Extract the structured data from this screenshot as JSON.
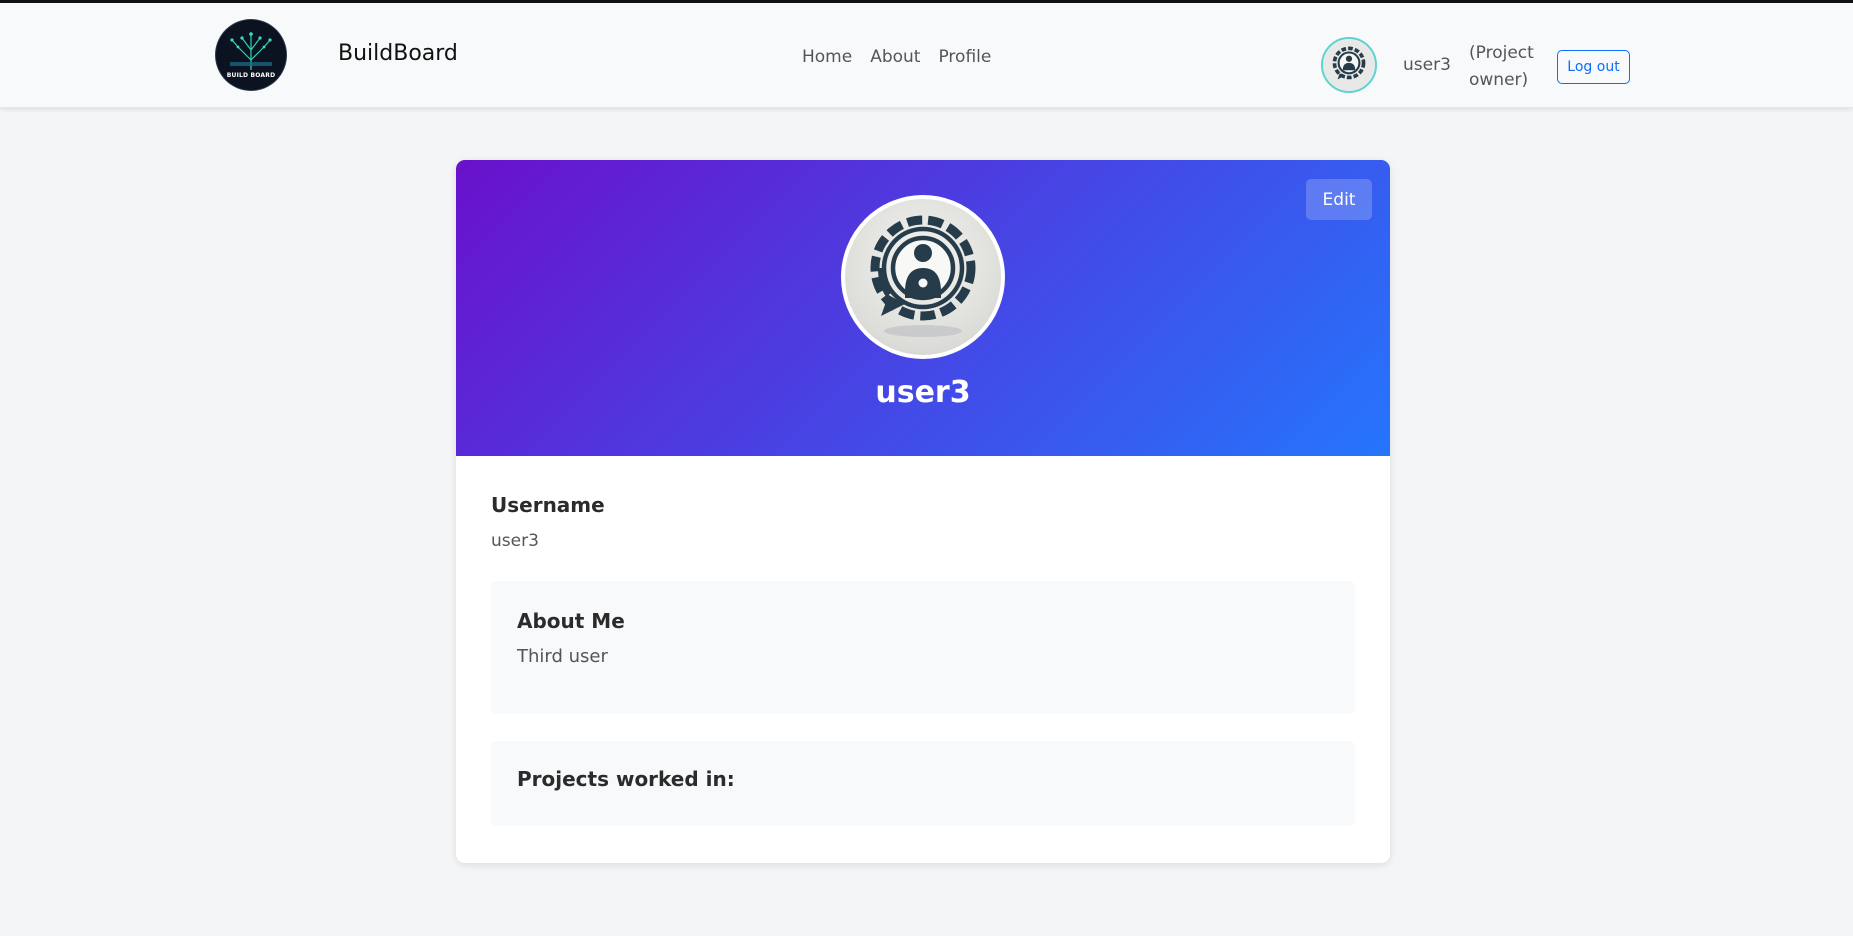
{
  "navbar": {
    "logo_text": "BUILD BOARD",
    "brand": "BuildBoard",
    "links": [
      {
        "label": "Home"
      },
      {
        "label": "About"
      },
      {
        "label": "Profile"
      }
    ],
    "avatar_icon": "user-chat-gear-icon",
    "username": "user3",
    "role": "(Project owner)",
    "logout_label": "Log out"
  },
  "profile": {
    "edit_label": "Edit",
    "name": "user3",
    "avatar_icon": "user-chat-gear-icon",
    "gradient": [
      "#6a11cb",
      "#2575fc"
    ],
    "username_label": "Username",
    "username_value": "user3",
    "about_title": "About Me",
    "about_text": "Third user",
    "projects_title": "Projects worked in:"
  },
  "colors": {
    "accent": "#0d6efd",
    "page_background": "#f4f5f7"
  }
}
